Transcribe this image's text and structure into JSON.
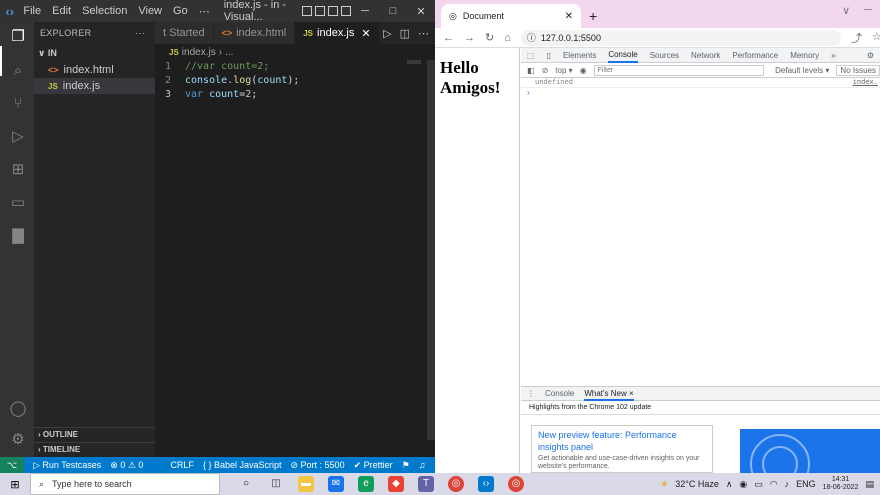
{
  "vscode": {
    "menu": [
      "File",
      "Edit",
      "Selection",
      "View",
      "Go",
      "⋯"
    ],
    "window_title": "index.js - in - Visual...",
    "explorer_label": "EXPLORER",
    "explorer_more": "···",
    "folder_name": "IN",
    "files": [
      "index.html",
      "index.js"
    ],
    "outline_label": "OUTLINE",
    "timeline_label": "TIMELINE",
    "tabs": [
      "t Started",
      "index.html",
      "index.js"
    ],
    "breadcrumb": [
      "index.js",
      "›",
      "..."
    ],
    "code_lines": [
      {
        "num": "1",
        "text": "//var count=2;"
      },
      {
        "num": "2",
        "text": "console.log(count);"
      },
      {
        "num": "3",
        "text": "var count=2;"
      }
    ],
    "status": {
      "run": "Run Testcases",
      "problems": "⊗ 0 ⚠ 0",
      "eol": "CRLF",
      "lang": "{ } Babel JavaScript",
      "port": "⊘ Port : 5500",
      "prettier": "✔ Prettier"
    }
  },
  "chrome": {
    "tab_title": "Document",
    "url": "127.0.0.1:5500",
    "page_heading_line1": "Hello",
    "page_heading_line2": "Amigos!",
    "devtools_tabs": [
      "Elements",
      "Console",
      "Sources",
      "Network",
      "Performance",
      "Memory",
      "»"
    ],
    "context": "top ▾",
    "filter_placeholder": "Filter",
    "levels": "Default levels ▾",
    "issues": "No Issues",
    "console_output": "undefined",
    "console_source": "index.",
    "drawer_tabs": [
      "Console",
      "What's New ×"
    ],
    "highlights": "Highlights from the Chrome 102 update",
    "card_title": "New preview feature: Performance insights panel",
    "card_desc": "Get actionable and use-case-driven insights on your website's performance."
  },
  "taskbar": {
    "search_placeholder": "Type here to search",
    "weather": "32°C  Haze",
    "lang": "ENG",
    "time": "14:31",
    "date": "18-06-2022"
  },
  "colors": {
    "vscode_status": "#007acc",
    "chrome_accent": "#1a73e8",
    "chrome_titlebar": "#f3d7ef"
  }
}
